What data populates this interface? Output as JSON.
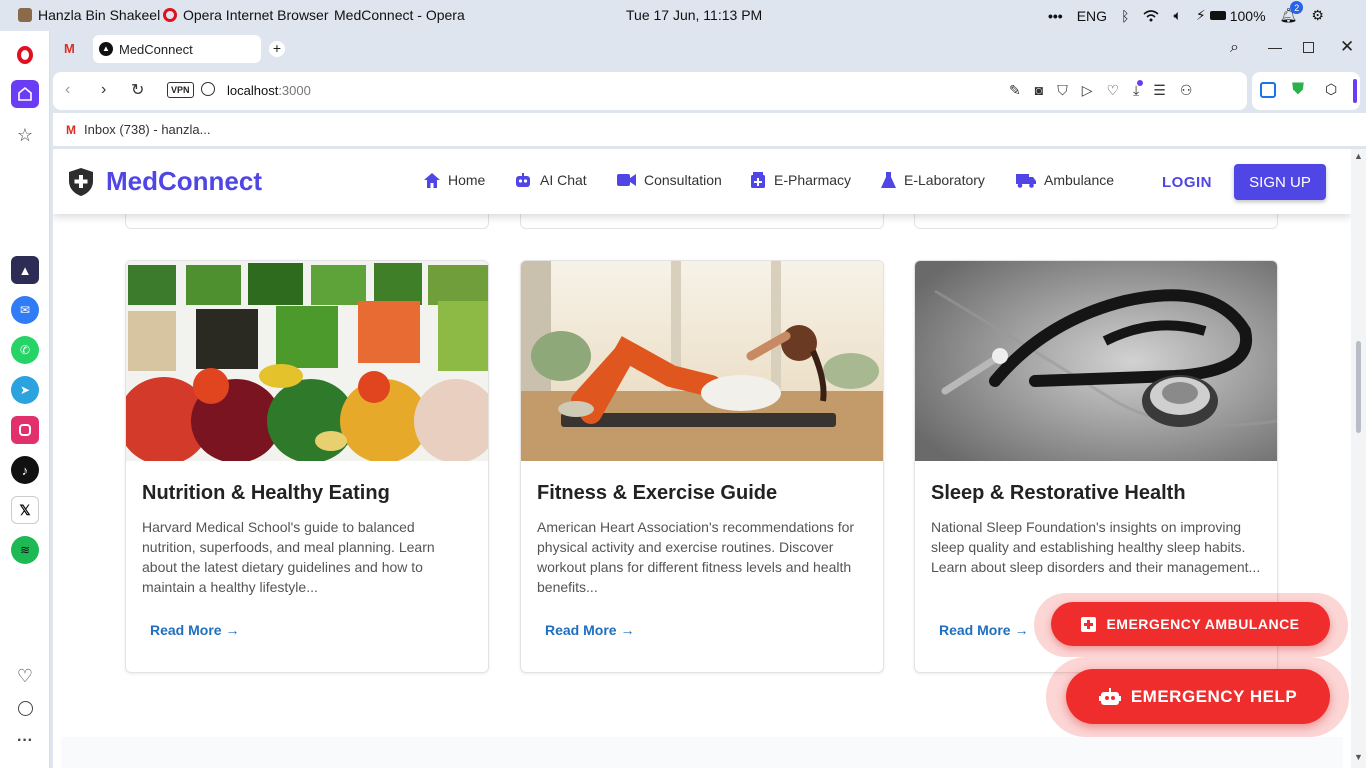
{
  "os": {
    "user": "Hanzla Bin Shakeel",
    "app": "Opera Internet Browser",
    "window_title": "MedConnect - Opera",
    "datetime": "Tue 17 Jun, 11:13 PM",
    "lang": "ENG",
    "battery": "100%",
    "notif_count": "2"
  },
  "browser": {
    "tab_title": "MedConnect",
    "url_host": "localhost",
    "url_port": ":3000",
    "vpn": "VPN",
    "bookmark": "Inbox (738) - hanzla..."
  },
  "site": {
    "brand": "MedConnect",
    "nav": [
      {
        "label": "Home"
      },
      {
        "label": "AI Chat"
      },
      {
        "label": "Consultation"
      },
      {
        "label": "E-Pharmacy"
      },
      {
        "label": "E-Laboratory"
      },
      {
        "label": "Ambulance"
      }
    ],
    "login": "LOGIN",
    "signup": "SIGN UP"
  },
  "cards": [
    {
      "title": "Nutrition & Healthy Eating",
      "text": "Harvard Medical School's guide to balanced nutrition, superfoods, and meal planning. Learn about the latest dietary guidelines and how to maintain a healthy lifestyle...",
      "link": "Read More →"
    },
    {
      "title": "Fitness & Exercise Guide",
      "text": "American Heart Association's recommendations for physical activity and exercise routines. Discover workout plans for different fitness levels and health benefits...",
      "link": "Read More →"
    },
    {
      "title": "Sleep & Restorative Health",
      "text": "National Sleep Foundation's insights on improving sleep quality and establishing healthy sleep habits. Learn about sleep disorders and their management...",
      "link": "Read More →"
    }
  ],
  "emergency": {
    "ambulance": "EMERGENCY AMBULANCE",
    "help": "EMERGENCY HELP"
  },
  "colors": {
    "brand": "#4f46e5",
    "link": "#1f6fbf",
    "emergency": "#ef2d2d"
  }
}
